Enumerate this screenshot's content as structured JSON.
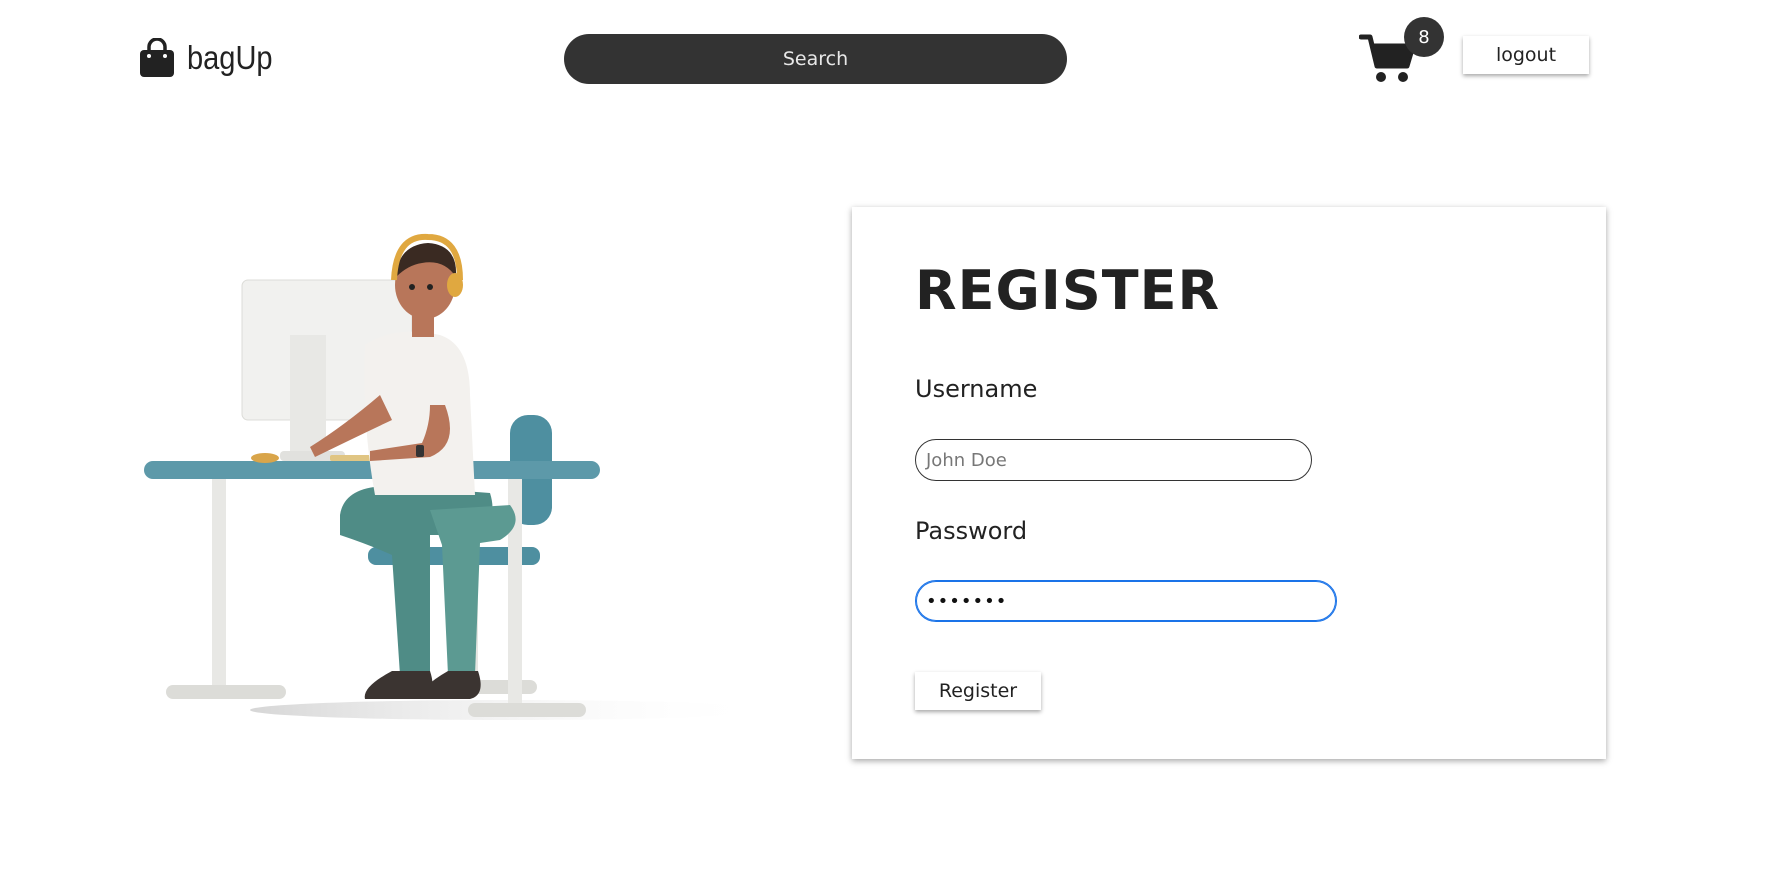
{
  "header": {
    "brand": "bagUp",
    "brand_icon": "shopping-bag-icon",
    "search_label": "Search",
    "cart_icon": "cart-icon",
    "cart_count": "8",
    "logout_label": "logout"
  },
  "illustration": {
    "icon": "person-at-computer-illustration"
  },
  "form": {
    "title": "REGISTER",
    "username_label": "Username",
    "username_placeholder": "John Doe",
    "password_label": "Password",
    "password_value": "•••••••",
    "submit_label": "Register"
  },
  "colors": {
    "dark": "#333333",
    "focus_border": "#1a73e8",
    "background": "#ffffff"
  }
}
